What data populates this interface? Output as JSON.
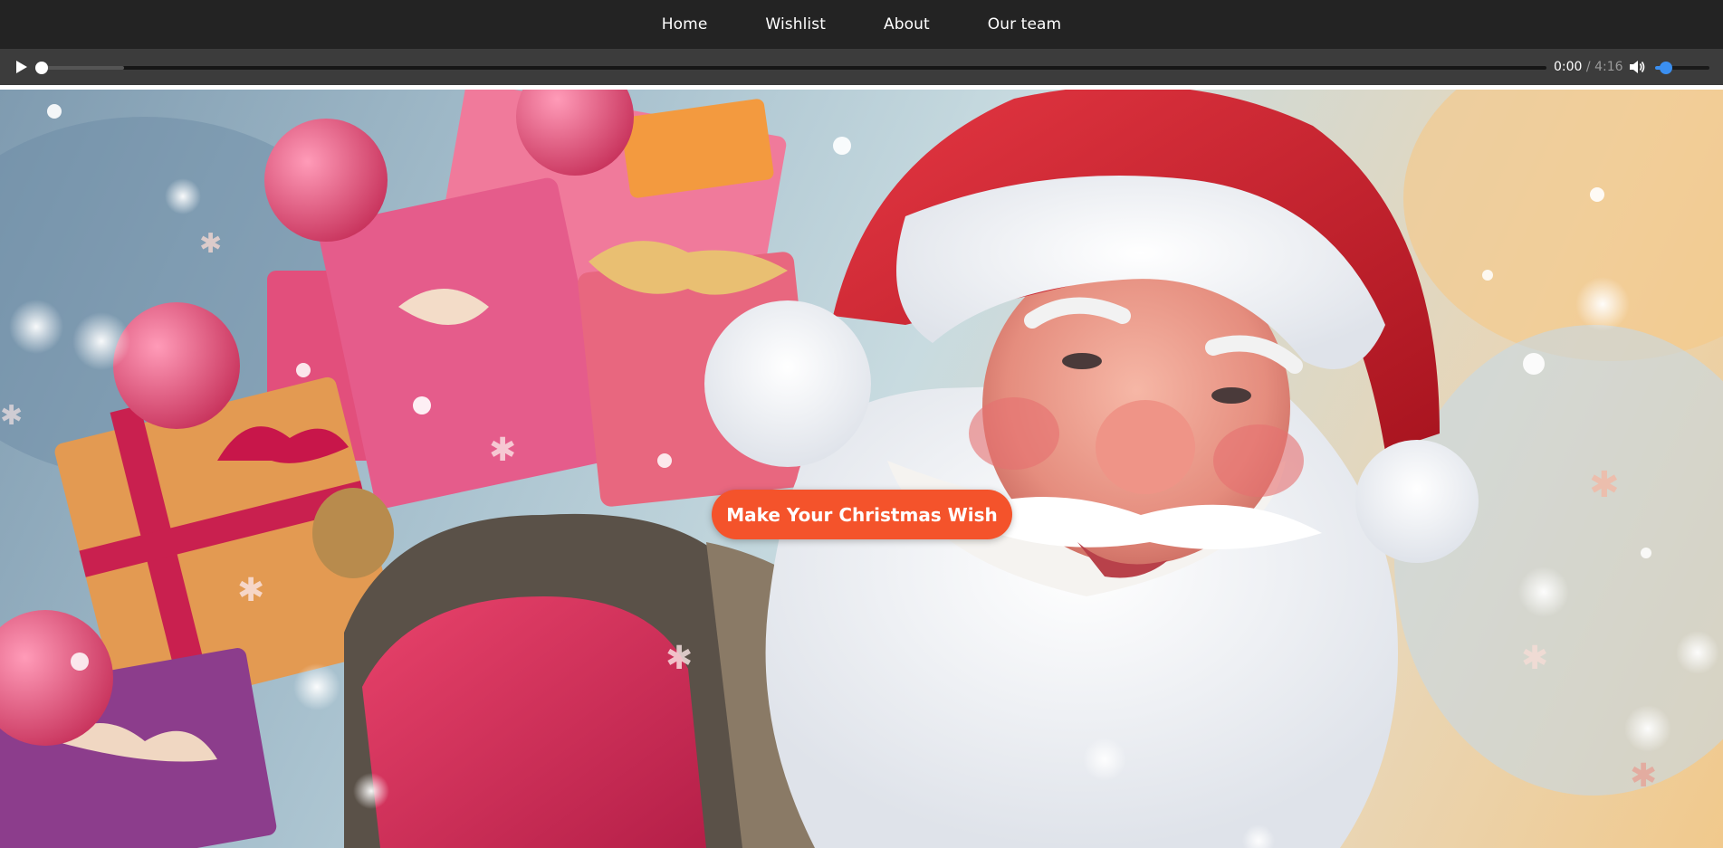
{
  "nav": {
    "items": [
      {
        "label": "Home"
      },
      {
        "label": "Wishlist"
      },
      {
        "label": "About"
      },
      {
        "label": "Our team"
      }
    ]
  },
  "player": {
    "play_icon": "play-icon",
    "volume_icon": "volume-icon",
    "current_time": "0:00",
    "separator": " / ",
    "total_time": "4:16",
    "progress": 0.0,
    "buffered": 0.055,
    "volume": 0.2,
    "accent_color": "#3b8ff0"
  },
  "hero": {
    "image": "santa-claus-with-gift-sack",
    "cta_label": "Make Your Christmas Wish",
    "cta_color": "#f4532b"
  }
}
